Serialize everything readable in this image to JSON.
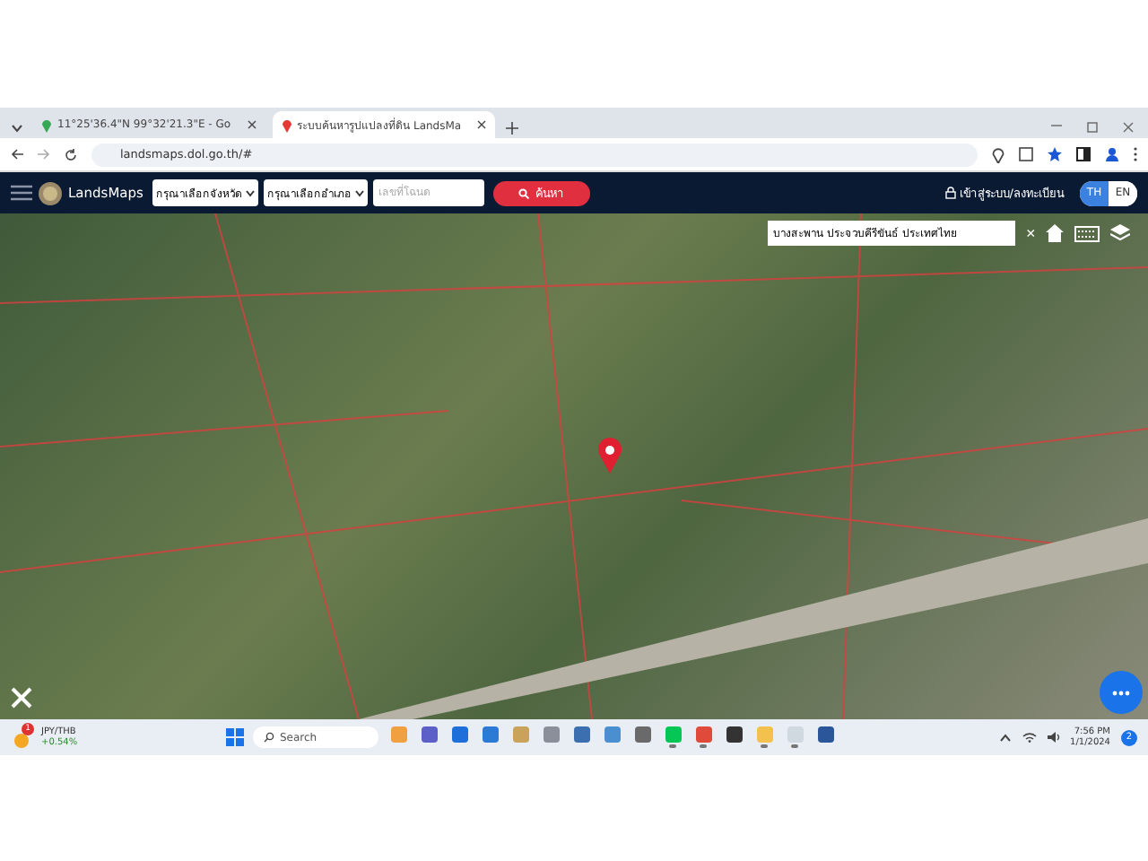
{
  "browser": {
    "tabs": [
      {
        "title": "11°25'36.4\"N 99°32'21.3\"E - Go",
        "selected": false
      },
      {
        "title": "ระบบค้นหารูปแปลงที่ดิน LandsMa",
        "selected": true
      }
    ],
    "address": "landsmaps.dol.go.th/#"
  },
  "app_bar": {
    "brand": "LandsMaps",
    "province_select": "กรุณาเลือกจังหวัด",
    "district_select": "กรุณาเลือกอำเภอ",
    "deed_placeholder": "เลขที่โฉนด",
    "search_button": "ค้นหา",
    "login": "เข้าสู่ระบบ/ลงทะเบียน",
    "languages": [
      {
        "label": "TH",
        "selected": true
      },
      {
        "label": "EN",
        "selected": false
      }
    ]
  },
  "map": {
    "location_search": "บางสะพาน ประจวบคีรีขันธ์ ประเทศไทย",
    "clear": "×"
  },
  "taskbar": {
    "widget_badge": "1",
    "widget_title": "JPY/THB",
    "widget_change": "+0.54%",
    "search": "Search",
    "apps": [
      {
        "running": false
      },
      {
        "running": false
      },
      {
        "running": false
      },
      {
        "running": false
      },
      {
        "running": false
      },
      {
        "running": false
      },
      {
        "running": false
      },
      {
        "running": false
      },
      {
        "running": false
      },
      {
        "running": true
      },
      {
        "running": true
      },
      {
        "running": false
      },
      {
        "running": true
      },
      {
        "running": true
      },
      {
        "running": false
      }
    ],
    "time": "7:56 PM",
    "date": "1/1/2024",
    "notification_count": "2"
  }
}
